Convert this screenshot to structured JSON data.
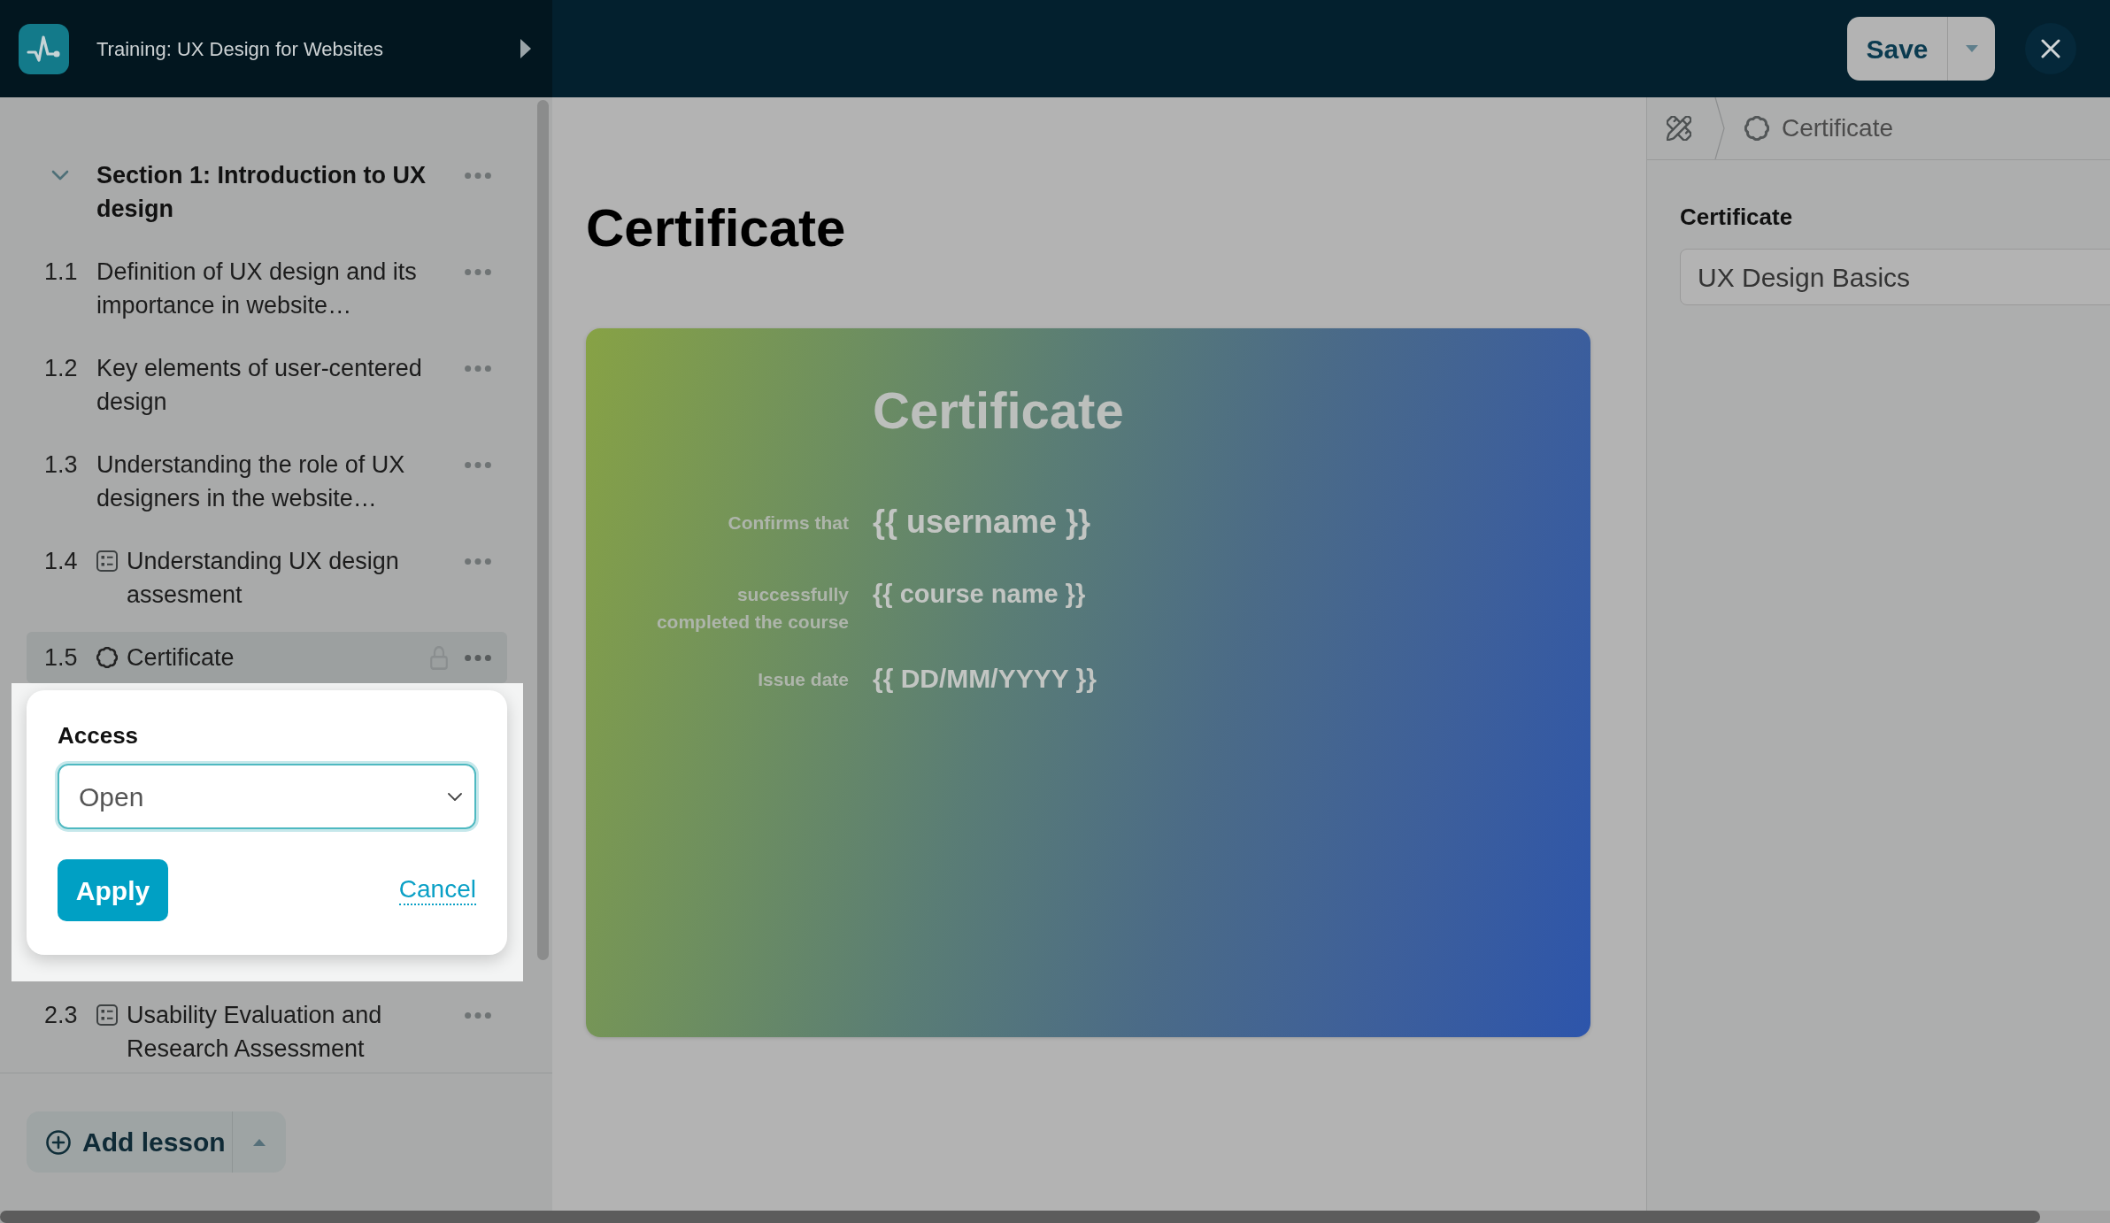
{
  "header": {
    "title": "Training: UX Design for Websites",
    "save_label": "Save"
  },
  "sidebar": {
    "section": {
      "title": "Section 1: Introduction to UX design",
      "expanded": true,
      "children": [
        {
          "number": "1.1",
          "title": "Definition of UX design and its importance in website…",
          "kind": "text",
          "selected": false,
          "locked": false
        },
        {
          "number": "1.2",
          "title": "Key elements of user-centered design",
          "kind": "text",
          "selected": false,
          "locked": false
        },
        {
          "number": "1.3",
          "title": "Understanding the role of UX designers in the website…",
          "kind": "text",
          "selected": false,
          "locked": false
        },
        {
          "number": "1.4",
          "title": "Understanding UX design assesment",
          "kind": "quiz",
          "selected": false,
          "locked": false
        },
        {
          "number": "1.5",
          "title": "Certificate",
          "kind": "certificate",
          "selected": true,
          "locked": true
        }
      ]
    },
    "lessons_below": [
      {
        "number": "2.3",
        "title": "Usability Evaluation and Research Assessment",
        "kind": "quiz",
        "selected": false,
        "locked": false
      }
    ],
    "add_button": "Add lesson"
  },
  "access_popover": {
    "label": "Access",
    "value": "Open",
    "apply": "Apply",
    "cancel": "Cancel"
  },
  "editor": {
    "title": "Certificate",
    "certificate": {
      "title": "Certificate",
      "rows": [
        {
          "label": "Confirms that",
          "value": "{{ username }}"
        },
        {
          "label": "successfully completed the course",
          "value": "{{ course name }}"
        },
        {
          "label": "Issue date",
          "value": "{{ DD/MM/YYYY }}"
        }
      ]
    }
  },
  "settings_panel": {
    "breadcrumb": "Certificate",
    "field_label": "Certificate",
    "field_value": "UX Design Basics"
  }
}
